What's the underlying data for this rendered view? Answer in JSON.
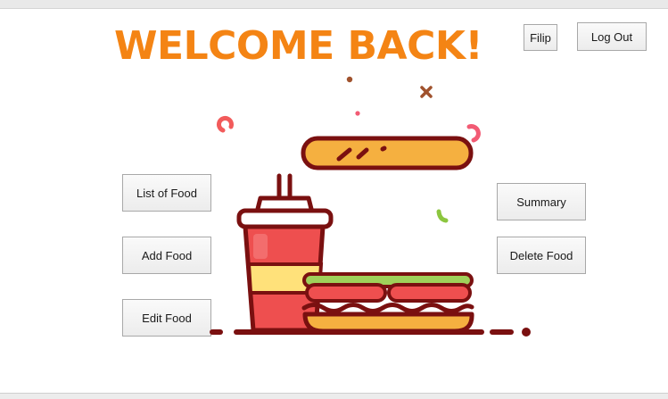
{
  "header": {
    "title": "WELCOME BACK!",
    "user_label": "Filip",
    "logout_label": "Log Out"
  },
  "menu": {
    "list_food": "List of Food",
    "add_food": "Add Food",
    "edit_food": "Edit Food",
    "summary": "Summary",
    "delete_food": "Delete Food"
  },
  "illustration": {
    "icon": "fast-food-illustration",
    "colors": {
      "outline": "#7a1010",
      "bun": "#f5b040",
      "cup_red": "#ee4f4f",
      "cup_yellow": "#ffe17a",
      "lettuce": "#9fd05a",
      "confetti_pink": "#f25b74",
      "confetti_brown": "#a0522d",
      "confetti_green": "#8cc63f"
    }
  },
  "theme": {
    "title_color": "#f48414",
    "background": "#ffffff"
  }
}
